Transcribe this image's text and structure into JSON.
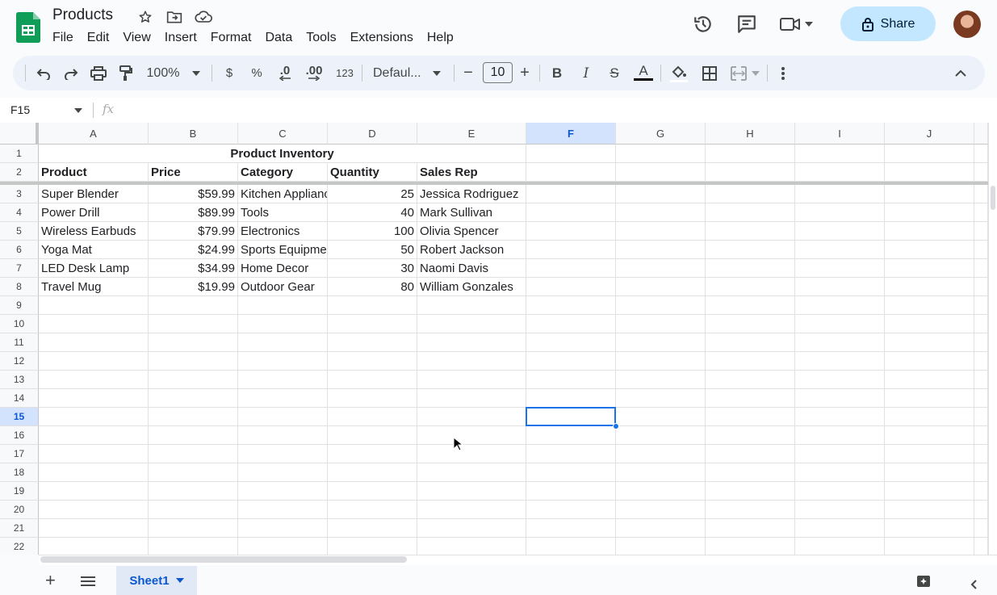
{
  "title": "Products",
  "menu": [
    "File",
    "Edit",
    "View",
    "Insert",
    "Format",
    "Data",
    "Tools",
    "Extensions",
    "Help"
  ],
  "share_label": "Share",
  "toolbar": {
    "zoom": "100%",
    "currency": "$",
    "percent": "%",
    "dec_decrease": ".0",
    "dec_increase": ".00",
    "number_format": "123",
    "font": "Defaul...",
    "font_size": "10",
    "minus": "−",
    "plus": "+"
  },
  "name_box": "F15",
  "fx": "fx",
  "columns": [
    "A",
    "B",
    "C",
    "D",
    "E",
    "F",
    "G",
    "H",
    "I",
    "J"
  ],
  "selected_column": "F",
  "selected_row": "15",
  "rows": [
    "1",
    "2",
    "3",
    "4",
    "5",
    "6",
    "7",
    "8",
    "9",
    "10",
    "11",
    "12",
    "13",
    "14",
    "15",
    "16",
    "17",
    "18",
    "19",
    "20",
    "21",
    "22"
  ],
  "sheet": {
    "title": "Product Inventory",
    "headers": [
      "Product",
      "Price",
      "Category",
      "Quantity",
      "Sales Rep"
    ],
    "data": [
      [
        "Super Blender",
        "$59.99",
        "Kitchen Appliances",
        "25",
        "Jessica Rodriguez"
      ],
      [
        "Power Drill",
        "$89.99",
        "Tools",
        "40",
        "Mark Sullivan"
      ],
      [
        "Wireless Earbuds",
        "$79.99",
        "Electronics",
        "100",
        "Olivia Spencer"
      ],
      [
        "Yoga Mat",
        "$24.99",
        "Sports Equipment",
        "50",
        "Robert Jackson"
      ],
      [
        "LED Desk Lamp",
        "$34.99",
        "Home Decor",
        "30",
        "Naomi Davis"
      ],
      [
        "Travel Mug",
        "$19.99",
        "Outdoor Gear",
        "80",
        "William Gonzales"
      ]
    ]
  },
  "sheet_tab": "Sheet1",
  "colors": {
    "accent": "#0b57d0",
    "share_bg": "#c2e7ff",
    "logo": "#0f9d58"
  }
}
